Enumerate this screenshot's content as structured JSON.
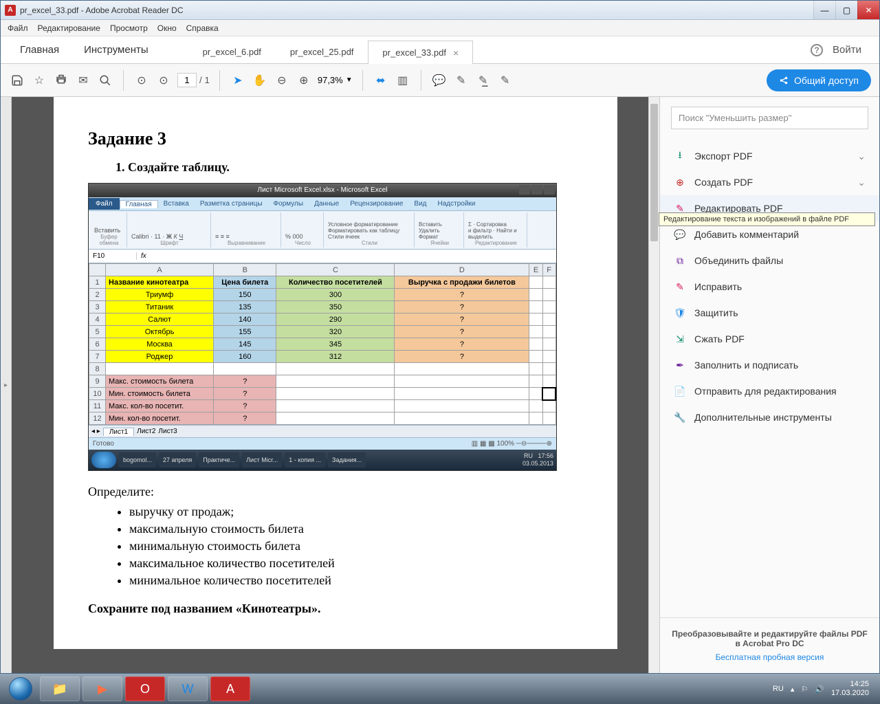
{
  "titlebar": {
    "text": "pr_excel_33.pdf - Adobe Acrobat Reader DC"
  },
  "menubar": [
    "Файл",
    "Редактирование",
    "Просмотр",
    "Окно",
    "Справка"
  ],
  "primary_tabs": {
    "home": "Главная",
    "tools": "Инструменты"
  },
  "doc_tabs": [
    {
      "label": "pr_excel_6.pdf",
      "active": false
    },
    {
      "label": "pr_excel_25.pdf",
      "active": false
    },
    {
      "label": "pr_excel_33.pdf",
      "active": true
    }
  ],
  "login": "Войти",
  "toolbar": {
    "page_current": "1",
    "page_total": "1",
    "page_sep": "/",
    "zoom": "97,3%",
    "share": "Общий доступ"
  },
  "doc": {
    "h1": "Задание 3",
    "step1": "1.  Создайте таблицу.",
    "determine": "Определите:",
    "bullets": [
      "выручку от продаж;",
      "максимальную стоимость билета",
      "минимальную стоимость билета",
      "максимальное количество посетителей",
      "минимальное количество посетителей"
    ],
    "save_as": "Сохраните под названием «Кинотеатры»."
  },
  "excel": {
    "title": "Лист Microsoft Excel.xlsx - Microsoft Excel",
    "file_tab": "Файл",
    "tabs": [
      "Главная",
      "Вставка",
      "Разметка страницы",
      "Формулы",
      "Данные",
      "Рецензирование",
      "Вид",
      "Надстройки"
    ],
    "ribbon_groups": [
      "Буфер обмена",
      "Шрифт",
      "Выравнивание",
      "Число",
      "Стили",
      "Ячейки",
      "Редактирование"
    ],
    "font_name": "Calibri",
    "font_size": "11",
    "namebox": "F10",
    "fx": "fx",
    "col_headers": [
      "A",
      "B",
      "C",
      "D",
      "E",
      "F"
    ],
    "header_row": [
      "Название кинотеатра",
      "Цена билета",
      "Количество посетителей",
      "Выручка с продажи билетов"
    ],
    "rows": [
      [
        "Триумф",
        "150",
        "300",
        "?"
      ],
      [
        "Титаник",
        "135",
        "350",
        "?"
      ],
      [
        "Салют",
        "140",
        "290",
        "?"
      ],
      [
        "Октябрь",
        "155",
        "320",
        "?"
      ],
      [
        "Москва",
        "145",
        "345",
        "?"
      ],
      [
        "Роджер",
        "160",
        "312",
        "?"
      ]
    ],
    "summary": [
      [
        "Макс. стоимость билета",
        "?"
      ],
      [
        "Мин. стоимость билета",
        "?"
      ],
      [
        "Макс. кол-во посетит.",
        "?"
      ],
      [
        "Мин. кол-во посетит.",
        "?"
      ]
    ],
    "sheets": [
      "Лист1",
      "Лист2",
      "Лист3"
    ],
    "status_ready": "Готово",
    "status_zoom": "100%",
    "task_apps": [
      "bogomol...",
      "27 апреля",
      "Практиче...",
      "Лист Micr...",
      "1 - копия ...",
      "Задания..."
    ],
    "task_lang": "RU",
    "task_time": "17:56",
    "task_date": "03.05.2013"
  },
  "tools": {
    "search_placeholder": "Поиск \"Уменьшить размер\"",
    "items": [
      "Экспорт PDF",
      "Создать PDF",
      "Редактировать PDF",
      "Добавить комментарий",
      "Объединить файлы",
      "Исправить",
      "Защитить",
      "Сжать PDF",
      "Заполнить и подписать",
      "Отправить для редактирования",
      "Дополнительные инструменты"
    ],
    "tooltip": "Редактирование текста и изображений в файле PDF",
    "footer1": "Преобразовывайте и редактируйте файлы PDF",
    "footer2": "в Acrobat Pro DC",
    "footer_link": "Бесплатная пробная версия"
  },
  "taskbar": {
    "lang": "RU",
    "time": "14:25",
    "date": "17.03.2020"
  }
}
